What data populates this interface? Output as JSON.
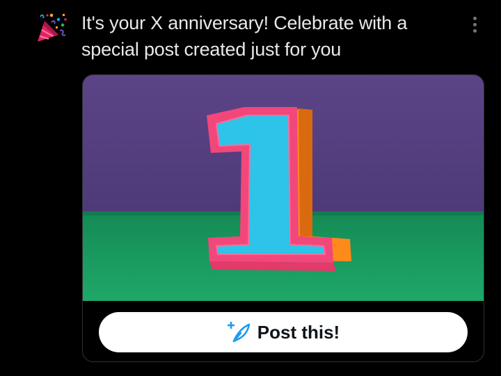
{
  "notification": {
    "icon": "party-popper-icon",
    "headline": "It's your X anniversary! Celebrate with a special post created just for you",
    "more_icon": "more-vertical-icon"
  },
  "card": {
    "image": "number-one-papercraft-image",
    "post_button": {
      "label": "Post this!",
      "icon": "compose-quill-sparkle-icon"
    }
  },
  "colors": {
    "background": "#000000",
    "text": "#e7e9ea",
    "muted": "#71767b",
    "accent": "#1d9bf0",
    "button_bg": "#ffffff",
    "button_text": "#0f1419",
    "image_wall": "#5a4183",
    "image_floor": "#1f9a5e",
    "numeral_pink": "#f2477a",
    "numeral_blue": "#2ec4ea",
    "numeral_orange": "#ff8a1c"
  }
}
